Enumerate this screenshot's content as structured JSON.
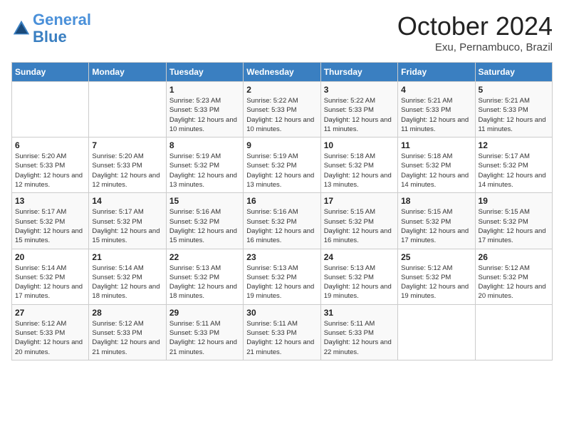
{
  "logo": {
    "line1": "General",
    "line2": "Blue"
  },
  "title": "October 2024",
  "location": "Exu, Pernambuco, Brazil",
  "days_of_week": [
    "Sunday",
    "Monday",
    "Tuesday",
    "Wednesday",
    "Thursday",
    "Friday",
    "Saturday"
  ],
  "weeks": [
    [
      {
        "day": "",
        "info": ""
      },
      {
        "day": "",
        "info": ""
      },
      {
        "day": "1",
        "info": "Sunrise: 5:23 AM\nSunset: 5:33 PM\nDaylight: 12 hours and 10 minutes."
      },
      {
        "day": "2",
        "info": "Sunrise: 5:22 AM\nSunset: 5:33 PM\nDaylight: 12 hours and 10 minutes."
      },
      {
        "day": "3",
        "info": "Sunrise: 5:22 AM\nSunset: 5:33 PM\nDaylight: 12 hours and 11 minutes."
      },
      {
        "day": "4",
        "info": "Sunrise: 5:21 AM\nSunset: 5:33 PM\nDaylight: 12 hours and 11 minutes."
      },
      {
        "day": "5",
        "info": "Sunrise: 5:21 AM\nSunset: 5:33 PM\nDaylight: 12 hours and 11 minutes."
      }
    ],
    [
      {
        "day": "6",
        "info": "Sunrise: 5:20 AM\nSunset: 5:33 PM\nDaylight: 12 hours and 12 minutes."
      },
      {
        "day": "7",
        "info": "Sunrise: 5:20 AM\nSunset: 5:33 PM\nDaylight: 12 hours and 12 minutes."
      },
      {
        "day": "8",
        "info": "Sunrise: 5:19 AM\nSunset: 5:32 PM\nDaylight: 12 hours and 13 minutes."
      },
      {
        "day": "9",
        "info": "Sunrise: 5:19 AM\nSunset: 5:32 PM\nDaylight: 12 hours and 13 minutes."
      },
      {
        "day": "10",
        "info": "Sunrise: 5:18 AM\nSunset: 5:32 PM\nDaylight: 12 hours and 13 minutes."
      },
      {
        "day": "11",
        "info": "Sunrise: 5:18 AM\nSunset: 5:32 PM\nDaylight: 12 hours and 14 minutes."
      },
      {
        "day": "12",
        "info": "Sunrise: 5:17 AM\nSunset: 5:32 PM\nDaylight: 12 hours and 14 minutes."
      }
    ],
    [
      {
        "day": "13",
        "info": "Sunrise: 5:17 AM\nSunset: 5:32 PM\nDaylight: 12 hours and 15 minutes."
      },
      {
        "day": "14",
        "info": "Sunrise: 5:17 AM\nSunset: 5:32 PM\nDaylight: 12 hours and 15 minutes."
      },
      {
        "day": "15",
        "info": "Sunrise: 5:16 AM\nSunset: 5:32 PM\nDaylight: 12 hours and 15 minutes."
      },
      {
        "day": "16",
        "info": "Sunrise: 5:16 AM\nSunset: 5:32 PM\nDaylight: 12 hours and 16 minutes."
      },
      {
        "day": "17",
        "info": "Sunrise: 5:15 AM\nSunset: 5:32 PM\nDaylight: 12 hours and 16 minutes."
      },
      {
        "day": "18",
        "info": "Sunrise: 5:15 AM\nSunset: 5:32 PM\nDaylight: 12 hours and 17 minutes."
      },
      {
        "day": "19",
        "info": "Sunrise: 5:15 AM\nSunset: 5:32 PM\nDaylight: 12 hours and 17 minutes."
      }
    ],
    [
      {
        "day": "20",
        "info": "Sunrise: 5:14 AM\nSunset: 5:32 PM\nDaylight: 12 hours and 17 minutes."
      },
      {
        "day": "21",
        "info": "Sunrise: 5:14 AM\nSunset: 5:32 PM\nDaylight: 12 hours and 18 minutes."
      },
      {
        "day": "22",
        "info": "Sunrise: 5:13 AM\nSunset: 5:32 PM\nDaylight: 12 hours and 18 minutes."
      },
      {
        "day": "23",
        "info": "Sunrise: 5:13 AM\nSunset: 5:32 PM\nDaylight: 12 hours and 19 minutes."
      },
      {
        "day": "24",
        "info": "Sunrise: 5:13 AM\nSunset: 5:32 PM\nDaylight: 12 hours and 19 minutes."
      },
      {
        "day": "25",
        "info": "Sunrise: 5:12 AM\nSunset: 5:32 PM\nDaylight: 12 hours and 19 minutes."
      },
      {
        "day": "26",
        "info": "Sunrise: 5:12 AM\nSunset: 5:32 PM\nDaylight: 12 hours and 20 minutes."
      }
    ],
    [
      {
        "day": "27",
        "info": "Sunrise: 5:12 AM\nSunset: 5:33 PM\nDaylight: 12 hours and 20 minutes."
      },
      {
        "day": "28",
        "info": "Sunrise: 5:12 AM\nSunset: 5:33 PM\nDaylight: 12 hours and 21 minutes."
      },
      {
        "day": "29",
        "info": "Sunrise: 5:11 AM\nSunset: 5:33 PM\nDaylight: 12 hours and 21 minutes."
      },
      {
        "day": "30",
        "info": "Sunrise: 5:11 AM\nSunset: 5:33 PM\nDaylight: 12 hours and 21 minutes."
      },
      {
        "day": "31",
        "info": "Sunrise: 5:11 AM\nSunset: 5:33 PM\nDaylight: 12 hours and 22 minutes."
      },
      {
        "day": "",
        "info": ""
      },
      {
        "day": "",
        "info": ""
      }
    ]
  ]
}
